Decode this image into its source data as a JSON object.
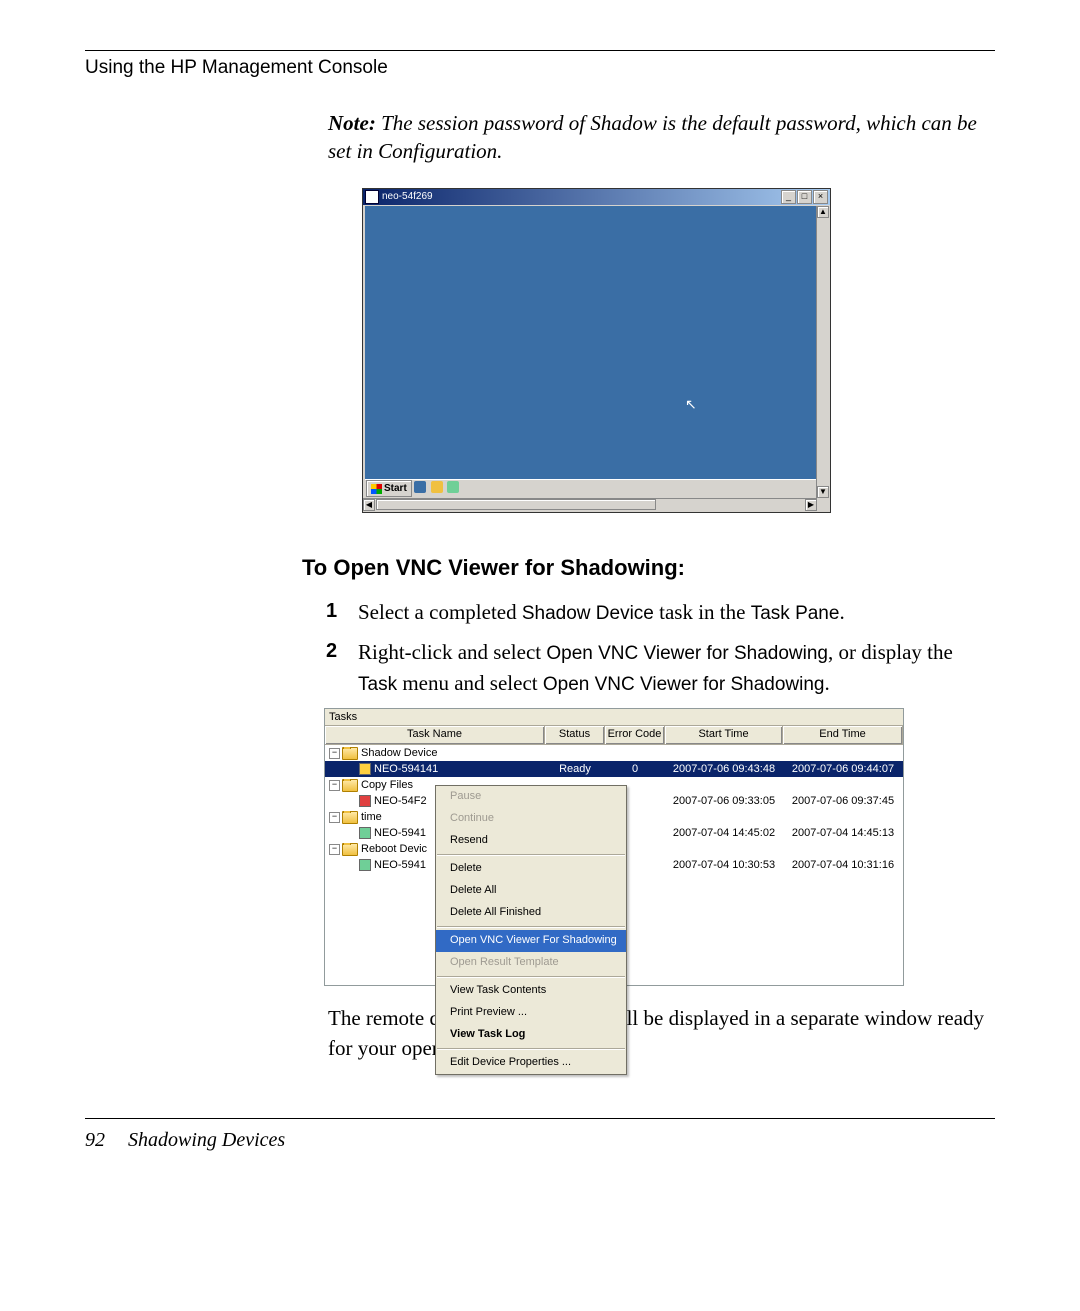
{
  "header": "Using the HP Management Console",
  "note": {
    "label": "Note:",
    "text": " The session password of Shadow is the default password, which can be set in Configuration."
  },
  "vnc": {
    "title": "neo-54f269",
    "start_label": "Start"
  },
  "section_heading": "To Open VNC Viewer for Shadowing:",
  "steps": [
    {
      "num": "1",
      "pre": "Select a completed ",
      "term1": "Shadow Device",
      "mid": " task in the ",
      "term2": "Task Pane",
      "post": "."
    },
    {
      "num": "2",
      "pre": "Right-click and select ",
      "term1": "Open VNC Viewer for Shadowing",
      "mid": ", or display the ",
      "term2": "Task",
      "mid2": " menu and select ",
      "term3": "Open VNC Viewer for Shadowing",
      "post": "."
    }
  ],
  "tasks_pane": {
    "title": "Tasks",
    "columns": {
      "task_name": "Task Name",
      "status": "Status",
      "error_code": "Error Code",
      "start_time": "Start Time",
      "end_time": "End Time"
    },
    "tree": {
      "root": "Shadow Device",
      "row_selected": {
        "name": "NEO-594141",
        "status": "Ready",
        "error": "0",
        "start": "2007-07-06 09:43:48",
        "end": "2007-07-06 09:44:07"
      },
      "group_copy": "Copy Files",
      "row_copy": {
        "name": "NEO-54F2",
        "start": "2007-07-06 09:33:05",
        "end": "2007-07-06 09:37:45"
      },
      "group_time": "time",
      "row_time": {
        "name": "NEO-5941",
        "start": "2007-07-04 14:45:02",
        "end": "2007-07-04 14:45:13"
      },
      "group_reboot": "Reboot Devic",
      "row_reboot": {
        "name": "NEO-5941",
        "start": "2007-07-04 10:30:53",
        "end": "2007-07-04 10:31:16"
      }
    },
    "context_menu": {
      "pause": "Pause",
      "continue": "Continue",
      "resend": "Resend",
      "delete": "Delete",
      "delete_all": "Delete All",
      "delete_finished": "Delete All Finished",
      "open_vnc": "Open VNC Viewer For Shadowing",
      "open_template": "Open Result Template",
      "view_contents": "View Task Contents",
      "print_preview": "Print Preview ...",
      "view_log": "View Task Log",
      "edit_props": "Edit Device Properties ..."
    }
  },
  "closing_text": "The remote desktop of the client will be displayed in a separate window ready for your operations.",
  "footer": {
    "page": "92",
    "section": "Shadowing Devices"
  }
}
